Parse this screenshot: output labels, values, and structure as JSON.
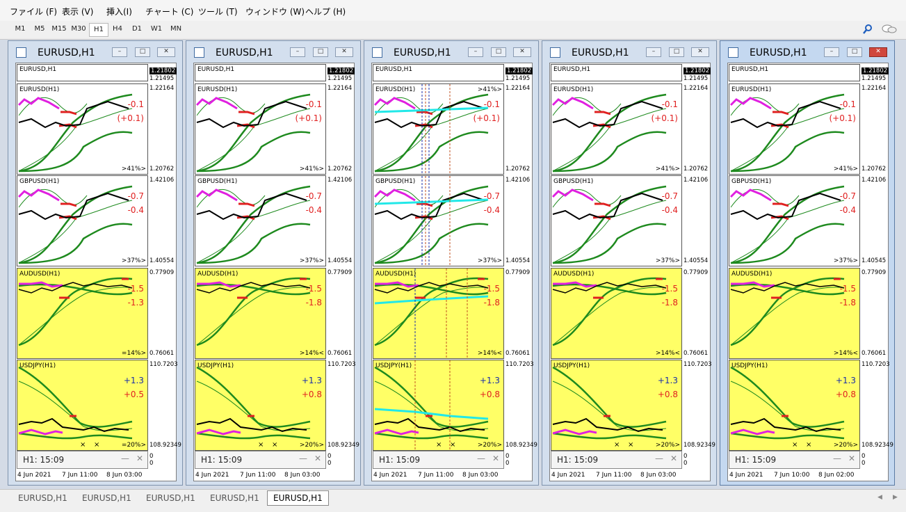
{
  "menu": [
    "ファイル (F)",
    "表示 (V)",
    "挿入(I)",
    "チャート (C)",
    "ツール (T)",
    "ウィンドウ (W)",
    "ヘルプ (H)"
  ],
  "timeframes": [
    "M1",
    "M5",
    "M15",
    "M30",
    "H1",
    "H4",
    "D1",
    "W1",
    "MN"
  ],
  "active_timeframe": "H1",
  "icons": {
    "search": "magnifier-icon",
    "chat": "chat-bubbles-icon",
    "window": "chart-window-icon"
  },
  "windows": [
    {
      "title": "EURUSD,H1",
      "top_bar": {
        "label": "EURUSD,H1",
        "price": "1.21802",
        "price_low": "1.21495"
      },
      "panels": [
        {
          "label": "EURUSD(H1)",
          "val1": "-0.1",
          "val2": "(+0.1)",
          "pct": ">41%>",
          "p_top": "1.22164",
          "p_bot": "1.20762"
        },
        {
          "label": "GBPUSD(H1)",
          "val1": "-0.7",
          "val2": "-0.4",
          "pct": ">37%>",
          "p_top": "1.42106",
          "p_bot": "1.40554"
        },
        {
          "label": "AUDUSD(H1)",
          "val1": "-1.5",
          "val2": "-1.3",
          "pct": "=14%>",
          "p_top": "0.77909",
          "p_bot": "0.76061"
        },
        {
          "label": "USDJPY(H1)",
          "val1": "+1.3",
          "val2": "+0.5",
          "pct": "=20%>",
          "p_top": "110.7203",
          "p_bot": "108.92349"
        }
      ],
      "timer": "H1: 15:09",
      "dates": [
        "4 Jun 2021",
        "7 Jun 11:00",
        "8 Jun 03:00"
      ]
    },
    {
      "title": "EURUSD,H1",
      "top_bar": {
        "label": "EURUSD,H1",
        "price": "1.21802",
        "price_low": "1.21495"
      },
      "panels": [
        {
          "label": "EURUSD(H1)",
          "val1": "-0.1",
          "val2": "(+0.1)",
          "pct": ">41%>",
          "p_top": "1.22164",
          "p_bot": "1.20762"
        },
        {
          "label": "GBPUSD(H1)",
          "val1": "-0.7",
          "val2": "-0.4",
          "pct": ">37%>",
          "p_top": "1.42106",
          "p_bot": "1.40554"
        },
        {
          "label": "AUDUSD(H1)",
          "val1": "-1.5",
          "val2": "-1.8",
          "pct": ">14%<",
          "p_top": "0.77909",
          "p_bot": "0.76061"
        },
        {
          "label": "USDJPY(H1)",
          "val1": "+1.3",
          "val2": "+0.8",
          "pct": ">20%>",
          "p_top": "110.7203",
          "p_bot": "108.92349"
        }
      ],
      "timer": "H1: 15:09",
      "dates": [
        "4 Jun 2021",
        "7 Jun 11:00",
        "8 Jun 03:00"
      ]
    },
    {
      "title": "EURUSD,H1",
      "top_bar": {
        "label": "EURUSD,H1",
        "price": "1.21802",
        "price_low": "1.21495"
      },
      "panels": [
        {
          "label": "EURUSD(H1)",
          "val1": "-0.1",
          "val2": "(+0.1)",
          "pct": ">41%>",
          "p_top": "1.22164",
          "p_bot": "1.20762",
          "pct_top": true
        },
        {
          "label": "GBPUSD(H1)",
          "val1": "-0.7",
          "val2": "-0.4",
          "pct": ">37%>",
          "p_top": "1.42106",
          "p_bot": "1.40554"
        },
        {
          "label": "AUDUSD(H1)",
          "val1": "-1.5",
          "val2": "-1.8",
          "pct": ">14%<",
          "p_top": "0.77909",
          "p_bot": "0.76061"
        },
        {
          "label": "USDJPY(H1)",
          "val1": "+1.3",
          "val2": "+0.8",
          "pct": ">20%>",
          "p_top": "110.7203",
          "p_bot": "108.92349"
        }
      ],
      "timer": "H1: 15:09",
      "dates": [
        "4 Jun 2021",
        "7 Jun 11:00",
        "8 Jun 03:00"
      ]
    },
    {
      "title": "EURUSD,H1",
      "top_bar": {
        "label": "EURUSD,H1",
        "price": "1.21802",
        "price_low": "1.21495"
      },
      "panels": [
        {
          "label": "EURUSD(H1)",
          "val1": "-0.1",
          "val2": "(+0.1)",
          "pct": ">41%>",
          "p_top": "1.22164",
          "p_bot": "1.20762"
        },
        {
          "label": "GBPUSD(H1)",
          "val1": "-0.7",
          "val2": "-0.4",
          "pct": ">37%>",
          "p_top": "1.42106",
          "p_bot": "1.40554"
        },
        {
          "label": "AUDUSD(H1)",
          "val1": "-1.5",
          "val2": "-1.8",
          "pct": ">14%<",
          "p_top": "0.77909",
          "p_bot": "0.76061"
        },
        {
          "label": "USDJPY(H1)",
          "val1": "+1.3",
          "val2": "+0.8",
          "pct": ">20%>",
          "p_top": "110.7203",
          "p_bot": "108.92349"
        }
      ],
      "timer": "H1: 15:09",
      "dates": [
        "4 Jun 2021",
        "7 Jun 11:00",
        "8 Jun 03:00"
      ]
    },
    {
      "title": "EURUSD,H1",
      "top_bar": {
        "label": "EURUSD,H1",
        "price": "1.21802",
        "price_low": "1.21495"
      },
      "panels": [
        {
          "label": "EURUSD(H1)",
          "val1": "-0.1",
          "val2": "(+0.1)",
          "pct": ">41%>",
          "p_top": "1.22164",
          "p_bot": "1.20762"
        },
        {
          "label": "GBPUSD(H1)",
          "val1": "-0.7",
          "val2": "-0.4",
          "pct": ">37%>",
          "p_top": "1.42106",
          "p_bot": "1.40545"
        },
        {
          "label": "AUDUSD(H1)",
          "val1": "-1.5",
          "val2": "-1.8",
          "pct": ">14%<",
          "p_top": "0.77909",
          "p_bot": "0.76061"
        },
        {
          "label": "USDJPY(H1)",
          "val1": "+1.3",
          "val2": "+0.8",
          "pct": ">20%>",
          "p_top": "110.7203",
          "p_bot": "108.92349"
        }
      ],
      "timer": "H1: 15:09",
      "dates": [
        "4 Jun 2021",
        "7 Jun 10:00",
        "8 Jun 02:00"
      ]
    }
  ],
  "timer_side": [
    "0",
    "0"
  ],
  "bottom_tabs": [
    "EURUSD,H1",
    "EURUSD,H1",
    "EURUSD,H1",
    "EURUSD,H1",
    "EURUSD,H1"
  ],
  "active_tab": 4,
  "colors": {
    "value_red": "#e02020",
    "value_blue": "#1a2ea8",
    "band_green": "#1e8a1e",
    "magenta": "#e020e0",
    "yellow": "#ffff66",
    "cyan": "#22e8e8"
  }
}
